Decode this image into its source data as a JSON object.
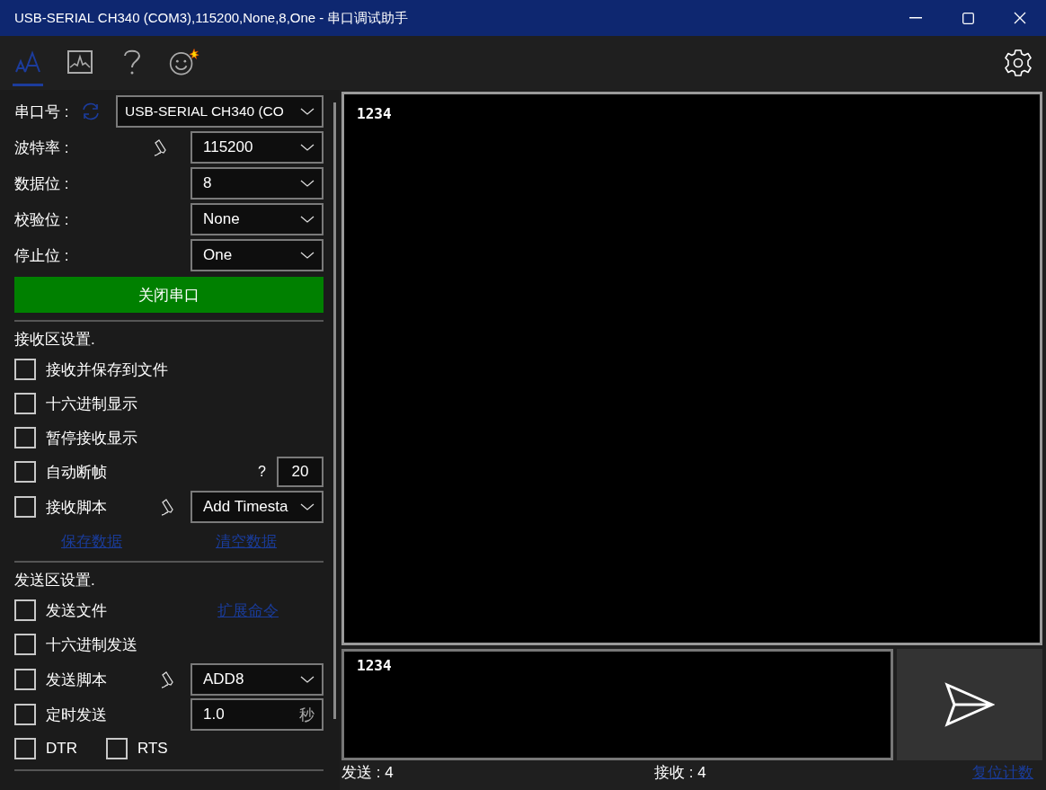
{
  "window": {
    "title": "USB-SERIAL CH340 (COM3),115200,None,8,One - 串口调试助手"
  },
  "toolbar": {
    "tabs": [
      {
        "kind": "font",
        "selected": true
      },
      {
        "kind": "chart",
        "selected": false
      },
      {
        "kind": "help",
        "selected": false
      },
      {
        "kind": "smiley",
        "selected": false
      }
    ]
  },
  "serial_settings": {
    "fields": [
      {
        "label": "串口号 :",
        "value": "USB-SERIAL CH340 (CO",
        "kind": "refresh"
      },
      {
        "label": "波特率 :",
        "value": "115200",
        "kind": "script"
      },
      {
        "label": "数据位 :",
        "value": "8",
        "kind": "plain"
      },
      {
        "label": "校验位 :",
        "value": "None",
        "kind": "plain"
      },
      {
        "label": "停止位 :",
        "value": "One",
        "kind": "plain"
      }
    ],
    "open_button": "关闭串口"
  },
  "receive_settings": {
    "title": "接收区设置.",
    "options": [
      {
        "kind": "plain",
        "label": "接收并保存到文件",
        "checked": false
      },
      {
        "kind": "plain",
        "label": "十六进制显示",
        "checked": false
      },
      {
        "kind": "plain",
        "label": "暂停接收显示",
        "checked": false
      },
      {
        "kind": "number",
        "label": "自动断帧",
        "checked": false,
        "help": "?",
        "value": "20"
      },
      {
        "kind": "script",
        "label": "接收脚本",
        "checked": false,
        "value": "Add Timesta"
      }
    ],
    "links": [
      "保存数据",
      "清空数据"
    ]
  },
  "send_settings": {
    "title": "发送区设置.",
    "options": [
      {
        "kind": "link",
        "label": "发送文件",
        "checked": false,
        "link": "扩展命令"
      },
      {
        "kind": "plain",
        "label": "十六进制发送",
        "checked": false
      },
      {
        "kind": "script",
        "label": "发送脚本",
        "checked": false,
        "value": "ADD8"
      },
      {
        "kind": "timer",
        "label": "定时发送",
        "checked": false,
        "value": "1.0",
        "unit": "秒"
      },
      {
        "kind": "pair",
        "label": "DTR",
        "checked": false,
        "second": {
          "label": "RTS",
          "checked": false
        }
      }
    ]
  },
  "receive_view": {
    "text": "1234"
  },
  "send_view": {
    "text": "1234"
  },
  "status_bar": {
    "sent": "发送 : 4",
    "received": "接收 : 4",
    "reset_link": "复位计数"
  }
}
